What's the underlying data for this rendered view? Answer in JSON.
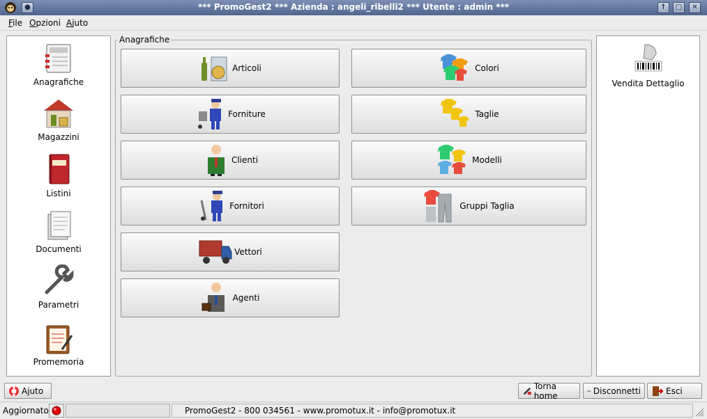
{
  "window": {
    "title": "*** PromoGest2 *** Azienda : angeli_ribelli2  *** Utente : admin ***"
  },
  "menu": [
    {
      "label": "File",
      "mnemonic": "F"
    },
    {
      "label": "Opzioni",
      "mnemonic": "O"
    },
    {
      "label": "Ajuto",
      "mnemonic": "A"
    }
  ],
  "left_nav": [
    {
      "label": "Anagrafiche",
      "icon": "address-book-icon"
    },
    {
      "label": "Magazzini",
      "icon": "warehouse-icon"
    },
    {
      "label": "Listini",
      "icon": "price-list-book-icon"
    },
    {
      "label": "Documenti",
      "icon": "documents-icon"
    },
    {
      "label": "Parametri",
      "icon": "wrench-icon"
    },
    {
      "label": "Promemoria",
      "icon": "memo-clipboard-icon"
    }
  ],
  "section": {
    "title": "Anagrafiche"
  },
  "left_buttons": [
    {
      "label": "Articoli",
      "icon": "articles-icon"
    },
    {
      "label": "Forniture",
      "icon": "supplies-worker-icon"
    },
    {
      "label": "Clienti",
      "icon": "customer-person-icon"
    },
    {
      "label": "Fornitori",
      "icon": "supplier-worker-icon"
    },
    {
      "label": "Vettori",
      "icon": "truck-icon"
    },
    {
      "label": "Agenti",
      "icon": "agent-businessman-icon"
    }
  ],
  "right_buttons": [
    {
      "label": "Colori",
      "icon": "color-shirts-icon"
    },
    {
      "label": "Taglie",
      "icon": "size-shirts-icon"
    },
    {
      "label": "Modelli",
      "icon": "model-shirts-icon"
    },
    {
      "label": "Gruppi Taglia",
      "icon": "size-group-clothes-icon"
    }
  ],
  "right_panel": {
    "label": "Vendita Dettaglio",
    "icon": "barcode-scanner-icon"
  },
  "bottom": {
    "help_label": "Ajuto",
    "home_label": "Torna home",
    "disconnect_label": "Disconnetti",
    "exit_label": "Esci"
  },
  "status": {
    "updated_label": "Aggiornato:",
    "footer_text": "PromoGest2 - 800 034561 - www.promotux.it - info@promotux.it"
  }
}
